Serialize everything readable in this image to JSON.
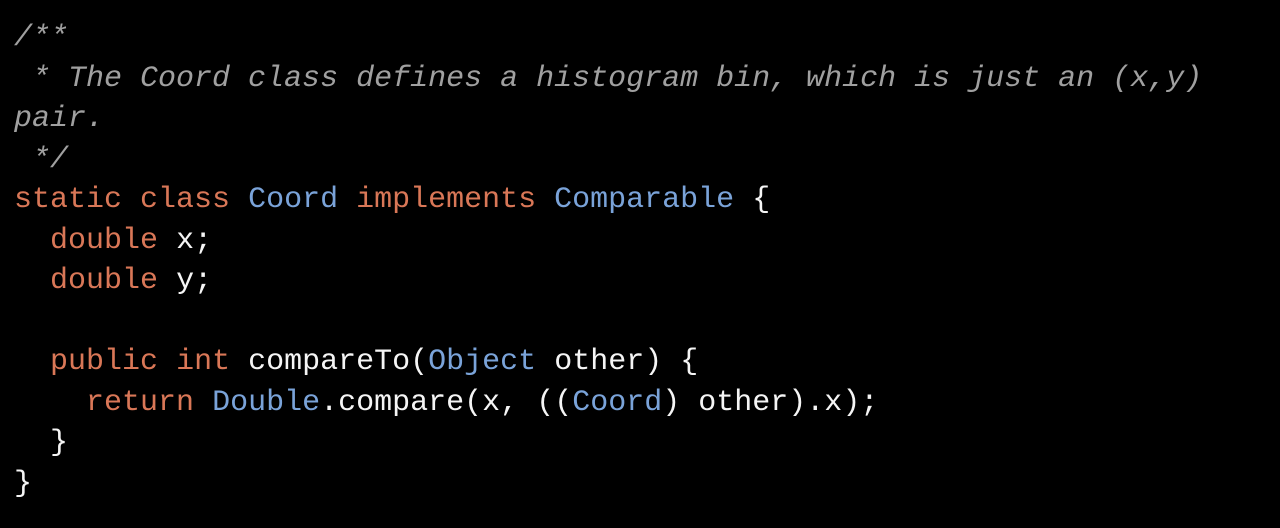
{
  "code": {
    "comment_open": "/**",
    "comment_line": " * The Coord class defines a histogram bin, which is just an (x,y) pair.",
    "comment_close": " */",
    "kw_static": "static",
    "kw_class": "class",
    "class_name": "Coord",
    "kw_implements": "implements",
    "iface_name": "Comparable",
    "brace_open": "{",
    "brace_close": "}",
    "kw_double_1": "double",
    "field_x": "x",
    "kw_double_2": "double",
    "field_y": "y",
    "semicolon": ";",
    "kw_public": "public",
    "kw_int": "int",
    "method_name": "compareTo",
    "paren_open": "(",
    "paren_close": ")",
    "param_type": "Object",
    "param_name": "other",
    "kw_return": "return",
    "double_class": "Double",
    "dot": ".",
    "compare_method": "compare",
    "arg_x": "x",
    "comma": ",",
    "cast_open": "((",
    "cast_type": "Coord",
    "cast_close": ")",
    "other_ref": "other",
    "field_access": ".x",
    "stmt_end": ");"
  }
}
